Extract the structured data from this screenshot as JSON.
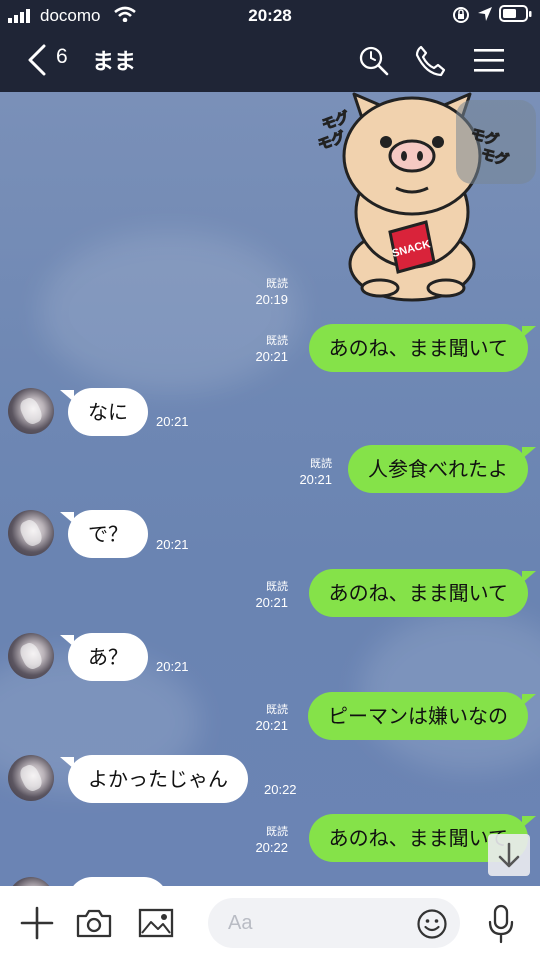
{
  "status_bar": {
    "carrier": "docomo",
    "time": "20:28"
  },
  "header": {
    "unread_count": "6",
    "title": "まま"
  },
  "sticker": {
    "mogu_left": "モグ\nモグ",
    "mogu_right": "モグ\nモグ",
    "bag_text": "SNACK",
    "read": "既読",
    "time": "20:19"
  },
  "messages": [
    {
      "side": "me",
      "text": "あのね、まま聞いて",
      "read": "既読",
      "time": "20:21"
    },
    {
      "side": "them",
      "text": "なに",
      "time": "20:21"
    },
    {
      "side": "me",
      "text": "人参食べれたよ",
      "read": "既読",
      "time": "20:21"
    },
    {
      "side": "them",
      "text": "で？",
      "time": "20:21"
    },
    {
      "side": "me",
      "text": "あのね、まま聞いて",
      "read": "既読",
      "time": "20:21"
    },
    {
      "side": "them",
      "text": "あ？",
      "time": "20:21"
    },
    {
      "side": "me",
      "text": "ピーマンは嫌いなの",
      "read": "既読",
      "time": "20:21"
    },
    {
      "side": "them",
      "text": "よかったじゃん",
      "time": "20:22"
    },
    {
      "side": "me",
      "text": "あのね、まま聞いて",
      "read": "既読",
      "time": "20:22"
    }
  ],
  "footer": {
    "input_placeholder": "Aa"
  },
  "colors": {
    "header_bg": "#1f2536",
    "my_bubble": "#85e249",
    "their_bubble": "#ffffff",
    "chat_bg": "#6f88b4"
  }
}
